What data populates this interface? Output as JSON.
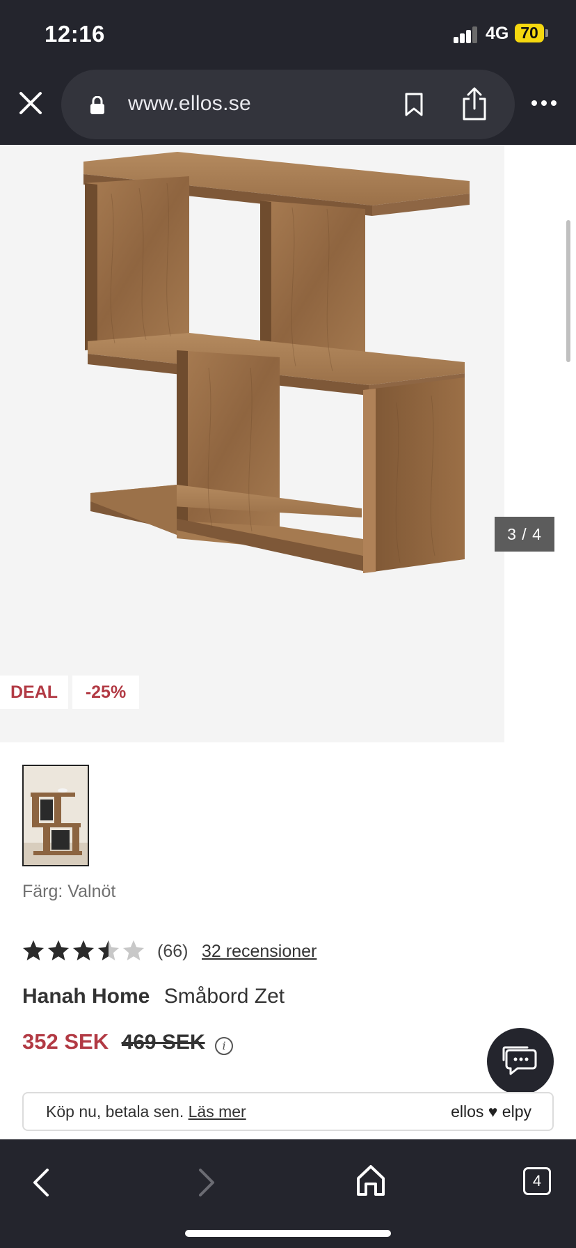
{
  "status_bar": {
    "time": "12:16",
    "network": "4G",
    "battery": "70"
  },
  "browser": {
    "url": "www.ellos.se",
    "icons": [
      "close-icon",
      "lock-icon",
      "bookmark-icon",
      "share-icon",
      "more-icon"
    ]
  },
  "gallery": {
    "badges": {
      "deal": "DEAL",
      "discount": "-25%"
    },
    "counter": "3 / 4",
    "current_image": 3,
    "total_images": 4
  },
  "product": {
    "color_label": "Färg: Valnöt",
    "rating": 3.5,
    "rating_max": 5,
    "rating_count": "(66)",
    "reviews_link": "32 recensioner",
    "brand": "Hanah Home",
    "name": "Småbord Zet",
    "price_now": "352 SEK",
    "price_old": "469 SEK"
  },
  "payment_banner": {
    "text": "Köp nu, betala sen.",
    "link": "Läs mer",
    "logo": "ellos ♥ elpy"
  },
  "bottom_nav": {
    "tab_count": "4",
    "icons": [
      "back-icon",
      "forward-icon",
      "home-icon",
      "tabs-icon"
    ]
  },
  "colors": {
    "chrome": "#24252d",
    "price_red": "#b23a44",
    "wood": "#9a7048"
  }
}
